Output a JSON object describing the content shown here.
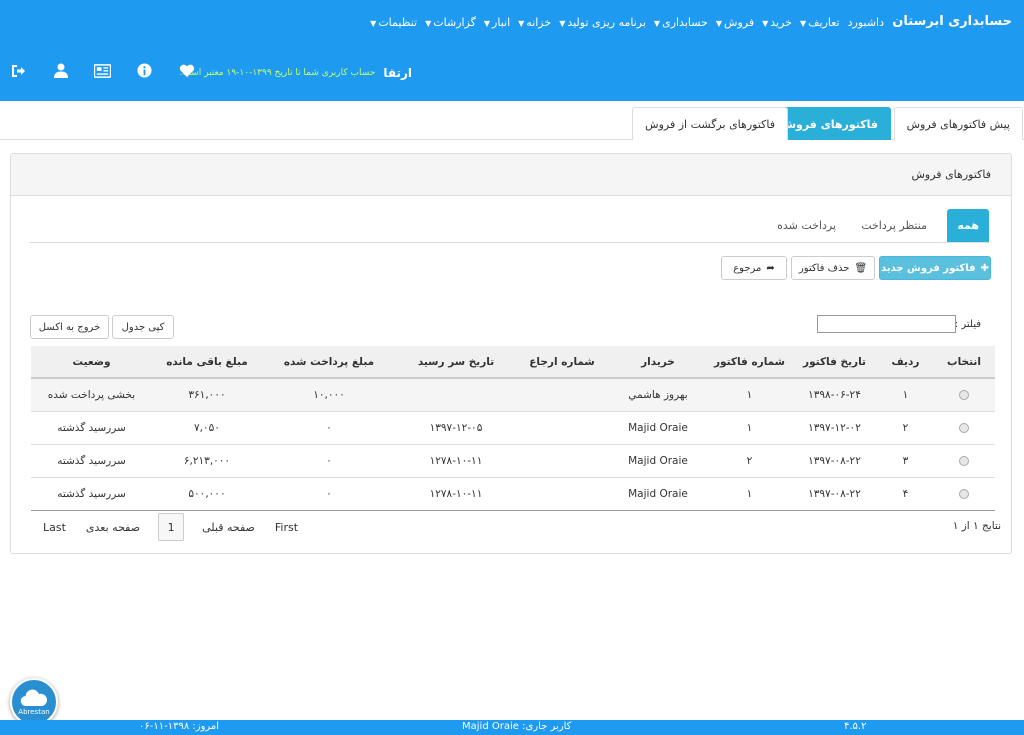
{
  "header": {
    "brand": "حسابداری ابرستان",
    "nav": [
      "داشبورد",
      "تعاریف",
      "خرید",
      "فروش",
      "حسابداری",
      "برنامه ریزی تولید",
      "خزانه",
      "انبار",
      "گزارشات",
      "تنظیمات"
    ],
    "account_name": "ارتقا",
    "account_note": "حساب کاربری شما تا تاریخ ۱۳۹۹-۱۰-۱۹ معتبر است.",
    "icons": [
      "logout-icon",
      "user-icon",
      "id-card-icon",
      "info-icon",
      "heart-icon"
    ]
  },
  "tabs": {
    "pre_invoices": "پیش فاکتورهای فروش",
    "sales_invoices": "فاکتورهای فروش",
    "returns": "فاکتورهای برگشت از فروش"
  },
  "panel": {
    "title": "فاکتورهای فروش",
    "filter_tabs": {
      "all": "همه",
      "pending": "منتظر پرداخت",
      "paid": "پرداخت شده"
    },
    "buttons": {
      "new_invoice": "فاکتور فروش جدید",
      "delete_invoice": "حذف فاکتور",
      "return": "مرجوع",
      "copy_table": "کپی جدول",
      "export_excel": "خروج به اکسل"
    },
    "filter_label": "فیلتر :",
    "filter_value": ""
  },
  "table": {
    "headers": [
      "انتخاب",
      "ردیف",
      "تاریخ فاکتور",
      "شماره فاکتور",
      "خریدار",
      "شماره ارجاع",
      "تاریخ سر رسید",
      "مبلغ پرداخت شده",
      "مبلغ باقی مانده",
      "وضعیت"
    ],
    "rows": [
      {
        "row": "۱",
        "date": "۱۳۹۸-۰۶-۲۴",
        "number": "۱",
        "buyer": "بهروز هاشمي",
        "ref": "",
        "due": "",
        "paid": "۱۰,۰۰۰",
        "remaining": "۳۶۱,۰۰۰",
        "status": "بخشی پرداخت شده",
        "status_type": "partial"
      },
      {
        "row": "۲",
        "date": "۱۳۹۷-۱۲-۰۲",
        "number": "۱",
        "buyer": "Majid Oraie",
        "ref": "",
        "due": "۱۳۹۷-۱۲-۰۵",
        "paid": "۰",
        "remaining": "۷,۰۵۰",
        "status": "سررسید گذشته",
        "status_type": "overdue"
      },
      {
        "row": "۳",
        "date": "۱۳۹۷-۰۸-۲۲",
        "number": "۲",
        "buyer": "Majid Oraie",
        "ref": "",
        "due": "۱۲۷۸-۱۰-۱۱",
        "paid": "۰",
        "remaining": "۶,۲۱۳,۰۰۰",
        "status": "سررسید گذشته",
        "status_type": "overdue"
      },
      {
        "row": "۴",
        "date": "۱۳۹۷-۰۸-۲۲",
        "number": "۱",
        "buyer": "Majid Oraie",
        "ref": "",
        "due": "۱۲۷۸-۱۰-۱۱",
        "paid": "۰",
        "remaining": "۵۰۰,۰۰۰",
        "status": "سررسید گذشته",
        "status_type": "overdue"
      }
    ]
  },
  "pager": {
    "results": "نتایج ۱ از ۱",
    "first": "First",
    "prev": "صفحه قبلی",
    "page": "1",
    "next": "صفحه بعدی",
    "last": "Last"
  },
  "footer": {
    "version": "۴.۵.۲",
    "current_user": "کاربر جاری: Majid Oraie",
    "today": "امروز: ۱۳۹۸-۱۱-۰۶"
  },
  "badge": {
    "label": "Abrestan"
  },
  "colors": {
    "header_bg": "#1e9bf0",
    "accent": "#2ab0d8",
    "partial": "#4caf50",
    "overdue": "#e53935"
  }
}
